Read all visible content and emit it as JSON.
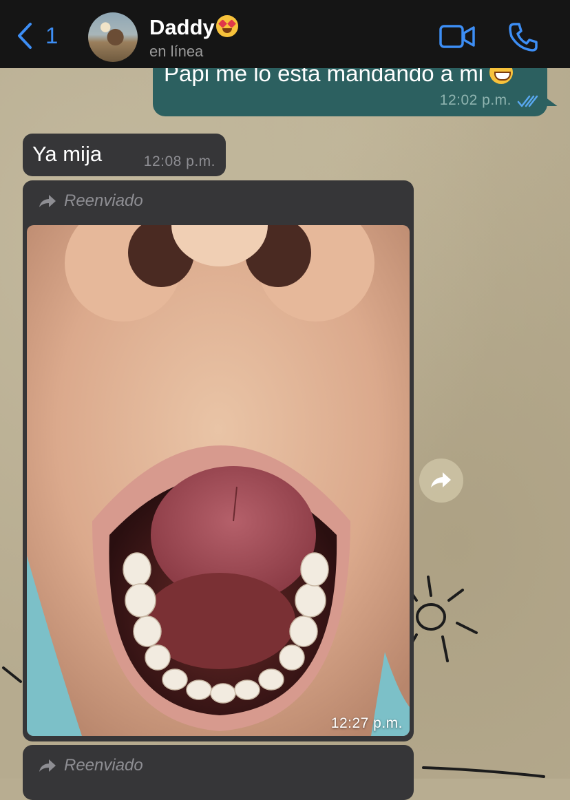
{
  "header": {
    "back_count": "1",
    "contact_name": "Daddy",
    "status": "en línea",
    "icons": [
      "chevron-left-icon",
      "video-call-icon",
      "phone-icon"
    ]
  },
  "messages": {
    "outgoing": {
      "text": "Papi me lo esta mandando a mi",
      "time": "12:02 p.m.",
      "status": "read"
    },
    "incoming": {
      "text": "Ya mija",
      "time": "12:08 p.m."
    },
    "forwarded_photo": {
      "forwarded_label": "Reenviado",
      "time": "12:27 p.m."
    },
    "forwarded_next": {
      "forwarded_label": "Reenviado"
    }
  },
  "colors": {
    "header_bg": "#151515",
    "accent": "#3d8ef5",
    "outgoing_bubble": "#2c6060",
    "incoming_bubble": "#363638"
  }
}
